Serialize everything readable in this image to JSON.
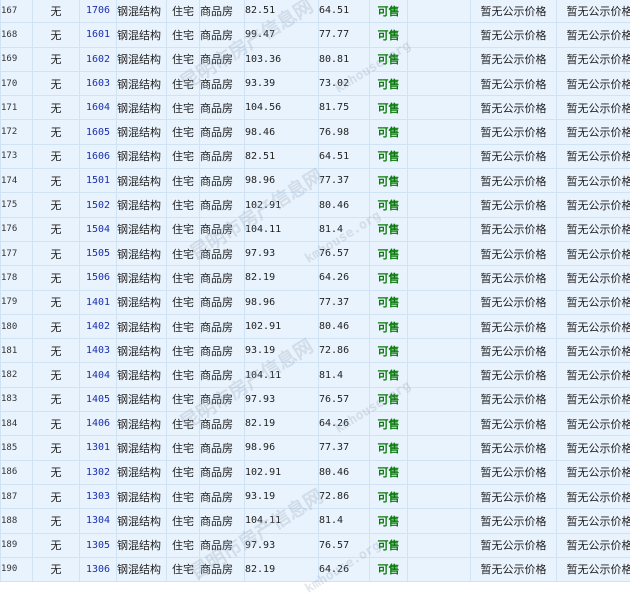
{
  "status_color": "#0a7a0a",
  "room_link_color": "#1a2fb0",
  "row_background": "#e9f3fd",
  "watermark": {
    "text": "昆明市房产信息网",
    "url": "kmhouse.org"
  },
  "rows": [
    {
      "no": "167",
      "wu": "无",
      "room": "1706",
      "struct": "钢混结构",
      "use": "住宅",
      "type": "商品房",
      "area1": "82.51",
      "area2": "64.51",
      "status": "可售",
      "price1": "暂无公示价格",
      "price2": "暂无公示价格"
    },
    {
      "no": "168",
      "wu": "无",
      "room": "1601",
      "struct": "钢混结构",
      "use": "住宅",
      "type": "商品房",
      "area1": "99.47",
      "area2": "77.77",
      "status": "可售",
      "price1": "暂无公示价格",
      "price2": "暂无公示价格"
    },
    {
      "no": "169",
      "wu": "无",
      "room": "1602",
      "struct": "钢混结构",
      "use": "住宅",
      "type": "商品房",
      "area1": "103.36",
      "area2": "80.81",
      "status": "可售",
      "price1": "暂无公示价格",
      "price2": "暂无公示价格"
    },
    {
      "no": "170",
      "wu": "无",
      "room": "1603",
      "struct": "钢混结构",
      "use": "住宅",
      "type": "商品房",
      "area1": "93.39",
      "area2": "73.02",
      "status": "可售",
      "price1": "暂无公示价格",
      "price2": "暂无公示价格"
    },
    {
      "no": "171",
      "wu": "无",
      "room": "1604",
      "struct": "钢混结构",
      "use": "住宅",
      "type": "商品房",
      "area1": "104.56",
      "area2": "81.75",
      "status": "可售",
      "price1": "暂无公示价格",
      "price2": "暂无公示价格"
    },
    {
      "no": "172",
      "wu": "无",
      "room": "1605",
      "struct": "钢混结构",
      "use": "住宅",
      "type": "商品房",
      "area1": "98.46",
      "area2": "76.98",
      "status": "可售",
      "price1": "暂无公示价格",
      "price2": "暂无公示价格"
    },
    {
      "no": "173",
      "wu": "无",
      "room": "1606",
      "struct": "钢混结构",
      "use": "住宅",
      "type": "商品房",
      "area1": "82.51",
      "area2": "64.51",
      "status": "可售",
      "price1": "暂无公示价格",
      "price2": "暂无公示价格"
    },
    {
      "no": "174",
      "wu": "无",
      "room": "1501",
      "struct": "钢混结构",
      "use": "住宅",
      "type": "商品房",
      "area1": "98.96",
      "area2": "77.37",
      "status": "可售",
      "price1": "暂无公示价格",
      "price2": "暂无公示价格"
    },
    {
      "no": "175",
      "wu": "无",
      "room": "1502",
      "struct": "钢混结构",
      "use": "住宅",
      "type": "商品房",
      "area1": "102.91",
      "area2": "80.46",
      "status": "可售",
      "price1": "暂无公示价格",
      "price2": "暂无公示价格"
    },
    {
      "no": "176",
      "wu": "无",
      "room": "1504",
      "struct": "钢混结构",
      "use": "住宅",
      "type": "商品房",
      "area1": "104.11",
      "area2": "81.4",
      "status": "可售",
      "price1": "暂无公示价格",
      "price2": "暂无公示价格"
    },
    {
      "no": "177",
      "wu": "无",
      "room": "1505",
      "struct": "钢混结构",
      "use": "住宅",
      "type": "商品房",
      "area1": "97.93",
      "area2": "76.57",
      "status": "可售",
      "price1": "暂无公示价格",
      "price2": "暂无公示价格"
    },
    {
      "no": "178",
      "wu": "无",
      "room": "1506",
      "struct": "钢混结构",
      "use": "住宅",
      "type": "商品房",
      "area1": "82.19",
      "area2": "64.26",
      "status": "可售",
      "price1": "暂无公示价格",
      "price2": "暂无公示价格"
    },
    {
      "no": "179",
      "wu": "无",
      "room": "1401",
      "struct": "钢混结构",
      "use": "住宅",
      "type": "商品房",
      "area1": "98.96",
      "area2": "77.37",
      "status": "可售",
      "price1": "暂无公示价格",
      "price2": "暂无公示价格"
    },
    {
      "no": "180",
      "wu": "无",
      "room": "1402",
      "struct": "钢混结构",
      "use": "住宅",
      "type": "商品房",
      "area1": "102.91",
      "area2": "80.46",
      "status": "可售",
      "price1": "暂无公示价格",
      "price2": "暂无公示价格"
    },
    {
      "no": "181",
      "wu": "无",
      "room": "1403",
      "struct": "钢混结构",
      "use": "住宅",
      "type": "商品房",
      "area1": "93.19",
      "area2": "72.86",
      "status": "可售",
      "price1": "暂无公示价格",
      "price2": "暂无公示价格"
    },
    {
      "no": "182",
      "wu": "无",
      "room": "1404",
      "struct": "钢混结构",
      "use": "住宅",
      "type": "商品房",
      "area1": "104.11",
      "area2": "81.4",
      "status": "可售",
      "price1": "暂无公示价格",
      "price2": "暂无公示价格"
    },
    {
      "no": "183",
      "wu": "无",
      "room": "1405",
      "struct": "钢混结构",
      "use": "住宅",
      "type": "商品房",
      "area1": "97.93",
      "area2": "76.57",
      "status": "可售",
      "price1": "暂无公示价格",
      "price2": "暂无公示价格"
    },
    {
      "no": "184",
      "wu": "无",
      "room": "1406",
      "struct": "钢混结构",
      "use": "住宅",
      "type": "商品房",
      "area1": "82.19",
      "area2": "64.26",
      "status": "可售",
      "price1": "暂无公示价格",
      "price2": "暂无公示价格"
    },
    {
      "no": "185",
      "wu": "无",
      "room": "1301",
      "struct": "钢混结构",
      "use": "住宅",
      "type": "商品房",
      "area1": "98.96",
      "area2": "77.37",
      "status": "可售",
      "price1": "暂无公示价格",
      "price2": "暂无公示价格"
    },
    {
      "no": "186",
      "wu": "无",
      "room": "1302",
      "struct": "钢混结构",
      "use": "住宅",
      "type": "商品房",
      "area1": "102.91",
      "area2": "80.46",
      "status": "可售",
      "price1": "暂无公示价格",
      "price2": "暂无公示价格"
    },
    {
      "no": "187",
      "wu": "无",
      "room": "1303",
      "struct": "钢混结构",
      "use": "住宅",
      "type": "商品房",
      "area1": "93.19",
      "area2": "72.86",
      "status": "可售",
      "price1": "暂无公示价格",
      "price2": "暂无公示价格"
    },
    {
      "no": "188",
      "wu": "无",
      "room": "1304",
      "struct": "钢混结构",
      "use": "住宅",
      "type": "商品房",
      "area1": "104.11",
      "area2": "81.4",
      "status": "可售",
      "price1": "暂无公示价格",
      "price2": "暂无公示价格"
    },
    {
      "no": "189",
      "wu": "无",
      "room": "1305",
      "struct": "钢混结构",
      "use": "住宅",
      "type": "商品房",
      "area1": "97.93",
      "area2": "76.57",
      "status": "可售",
      "price1": "暂无公示价格",
      "price2": "暂无公示价格"
    },
    {
      "no": "190",
      "wu": "无",
      "room": "1306",
      "struct": "钢混结构",
      "use": "住宅",
      "type": "商品房",
      "area1": "82.19",
      "area2": "64.26",
      "status": "可售",
      "price1": "暂无公示价格",
      "price2": "暂无公示价格"
    }
  ]
}
